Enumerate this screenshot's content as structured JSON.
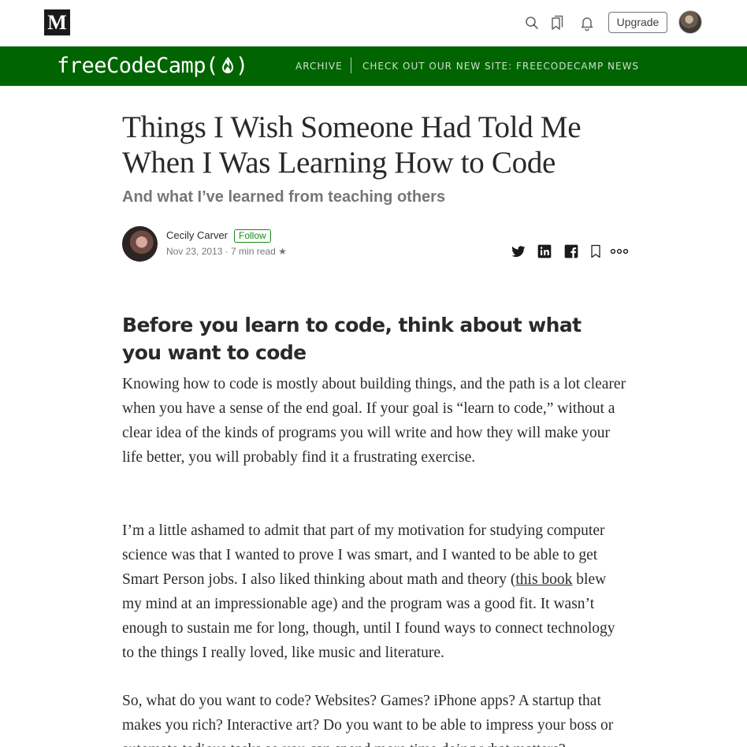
{
  "topbar": {
    "logo_text": "M",
    "icons": [
      "search-icon",
      "bookmarks-icon",
      "bell-icon"
    ],
    "upgrade_label": "Upgrade"
  },
  "publication": {
    "name": "freeCodeCamp(🔥)",
    "logo_text": "freeCodeCamp(",
    "logo_close": ")",
    "nav": [
      "ARCHIVE",
      "CHECK OUT OUR NEW SITE: FREECODECAMP NEWS"
    ],
    "brand_color": "#006400"
  },
  "article": {
    "title": "Things I Wish Someone Had Told Me When I Was Learning How to Code",
    "subtitle": "And what I’ve learned from teaching others",
    "author": "Cecily Carver",
    "follow_label": "Follow",
    "meta": "Nov 23, 2013 · 7 min read ★",
    "share_icons": [
      "twitter-icon",
      "linkedin-icon",
      "facebook-icon",
      "bookmark-icon",
      "more-icon"
    ],
    "heading": "Before you learn to code, think about what you want to code",
    "p1": "Knowing how to code is mostly about building things, and the path is a lot clearer when you have a sense of the end goal. If your goal is “learn to code,” without a clear idea of the kinds of programs you will write and how they will make your life better, you will probably find it a frustrating exercise.",
    "p2_before": "I’m a little ashamed to admit that part of my motivation for studying computer science was that I wanted to prove I was smart, and I wanted to be able to get Smart Person jobs. I also liked thinking about math and theory (",
    "p2_link": "this book",
    "p2_after": " blew my mind at an impressionable age) and the program was a good fit. It wasn’t enough to sustain me for long, though, until I found ways to connect technology to the things I really loved, like music and literature.",
    "p3": "So, what do you want to code? Websites? Games? iPhone apps? A startup that makes you rich? Interactive art? Do you want to be able to impress your boss or automate tedious tasks so you can spend more time doing what matters?"
  }
}
